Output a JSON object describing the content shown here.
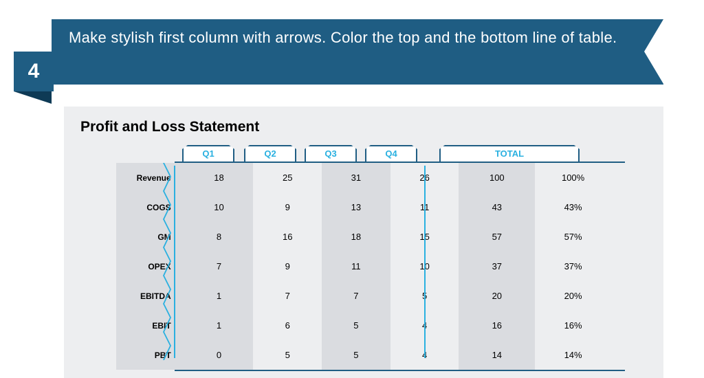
{
  "banner_text": "Make stylish first column with arrows. Color the top and the bottom line of table.",
  "step_number": "4",
  "card_title": "Profit and Loss Statement",
  "chart_data": {
    "type": "table",
    "title": "Profit and Loss Statement",
    "columns": [
      "Q1",
      "Q2",
      "Q3",
      "Q4",
      "TOTAL",
      "TOTAL %"
    ],
    "rows": [
      {
        "label": "Revenue",
        "q1": "18",
        "q2": "25",
        "q3": "31",
        "q4": "26",
        "total": "100",
        "pct": "100%"
      },
      {
        "label": "COGS",
        "q1": "10",
        "q2": "9",
        "q3": "13",
        "q4": "11",
        "total": "43",
        "pct": "43%"
      },
      {
        "label": "GM",
        "q1": "8",
        "q2": "16",
        "q3": "18",
        "q4": "15",
        "total": "57",
        "pct": "57%"
      },
      {
        "label": "OPEX",
        "q1": "7",
        "q2": "9",
        "q3": "11",
        "q4": "10",
        "total": "37",
        "pct": "37%"
      },
      {
        "label": "EBITDA",
        "q1": "1",
        "q2": "7",
        "q3": "7",
        "q4": "5",
        "total": "20",
        "pct": "20%"
      },
      {
        "label": "EBIT",
        "q1": "1",
        "q2": "6",
        "q3": "5",
        "q4": "4",
        "total": "16",
        "pct": "16%"
      },
      {
        "label": "PBT",
        "q1": "0",
        "q2": "5",
        "q3": "5",
        "q4": "4",
        "total": "14",
        "pct": "14%"
      }
    ]
  },
  "tabs": {
    "q1": "Q1",
    "q2": "Q2",
    "q3": "Q3",
    "q4": "Q4",
    "total": "TOTAL"
  }
}
